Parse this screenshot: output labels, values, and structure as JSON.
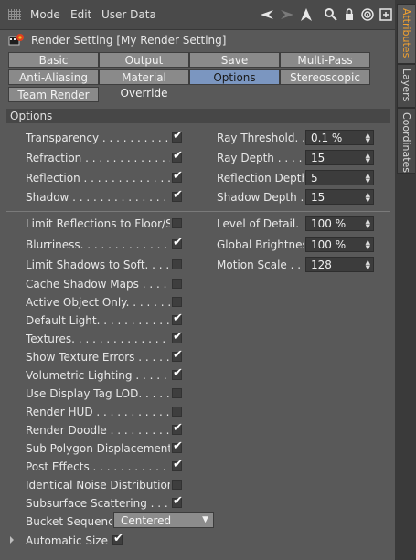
{
  "menubar": {
    "mode": "Mode",
    "edit": "Edit",
    "user_data": "User Data"
  },
  "title": "Render Setting [My Render Setting]",
  "tabs_row1": [
    "Basic",
    "Output",
    "Save",
    "Multi-Pass"
  ],
  "tabs_row2": [
    "Anti-Aliasing",
    "Material Override",
    "Options",
    "Stereoscopic"
  ],
  "tabs_row3": [
    "Team Render"
  ],
  "active_tab": "Options",
  "section": "Options",
  "left_group1": [
    {
      "label": "Transparency . . . . . . . . . . . .",
      "checked": true
    },
    {
      "label": "Refraction . . . . . . . . . . . . . .",
      "checked": true
    },
    {
      "label": "Reflection . . . . . . . . . . . . . .",
      "checked": true
    },
    {
      "label": "Shadow . . . . . . . . . . . . . . . .",
      "checked": true
    }
  ],
  "right_group1": [
    {
      "label": "Ray Threshold. . .",
      "value": "0.1 %"
    },
    {
      "label": "Ray Depth . . . . . .",
      "value": "15"
    },
    {
      "label": "Reflection Depth",
      "value": "5"
    },
    {
      "label": "Shadow Depth . .",
      "value": "15"
    }
  ],
  "left_group2": [
    {
      "label": "Limit Reflections to Floor/Sky",
      "checked": false
    },
    {
      "label": "Blurriness. . . . . . . . . . . . . .",
      "checked": true
    },
    {
      "label": "Limit Shadows to Soft. . . . . . .",
      "checked": false
    },
    {
      "label": "Cache Shadow Maps . . . . . . . .",
      "checked": false
    },
    {
      "label": "Active Object Only. . . . . . . . . .",
      "checked": false
    },
    {
      "label": "Default Light. . . . . . . . . . . . .",
      "checked": true
    },
    {
      "label": "Textures. . . . . . . . . . . . . . . .",
      "checked": true
    },
    {
      "label": "Show Texture Errors . . . . . . . .",
      "checked": true
    },
    {
      "label": "Volumetric Lighting . . . . . . . .",
      "checked": true
    },
    {
      "label": "Use Display Tag LOD. . . . . . . .",
      "checked": false
    },
    {
      "label": "Render HUD . . . . . . . . . . . . .",
      "checked": false
    },
    {
      "label": "Render Doodle . . . . . . . . . . . .",
      "checked": true
    },
    {
      "label": "Sub Polygon Displacement . . .",
      "checked": true
    },
    {
      "label": "Post Effects . . . . . . . . . . . . .",
      "checked": true
    },
    {
      "label": "Identical Noise Distribution . . .",
      "checked": false
    },
    {
      "label": "Subsurface Scattering . . . . . . .",
      "checked": true
    }
  ],
  "right_group2": [
    {
      "label": "Level of Detail. . . .",
      "value": "100 %"
    },
    {
      "label": "Global Brightness",
      "value": "100 %"
    },
    {
      "label": "Motion Scale . . . .",
      "value": "128"
    }
  ],
  "bucket": {
    "label": "Bucket Sequence",
    "value": "Centered"
  },
  "automatic_size": {
    "label": "Automatic Size",
    "checked": true
  },
  "side_tabs": [
    "Attributes",
    "Layers",
    "Coordinates"
  ],
  "colors": {
    "active_tab": "#7b96c0",
    "accent": "#f0a030"
  }
}
